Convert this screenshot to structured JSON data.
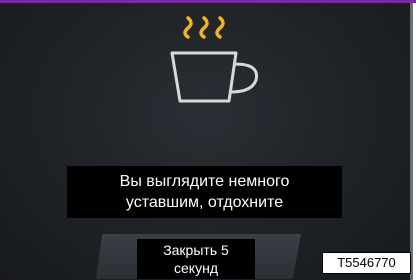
{
  "dialog": {
    "message_line1": "Вы выглядите немного",
    "message_line2": "уставшим, отдохните",
    "close_line1": "Закрыть 5",
    "close_line2": "секунд",
    "icon": "coffee-cup-icon"
  },
  "reference_code": "T5546770",
  "colors": {
    "background": "#1e2226",
    "steam": "#f0b41e",
    "cup_outline": "#d8d8d8",
    "accent_band": "#7a2a9a"
  }
}
